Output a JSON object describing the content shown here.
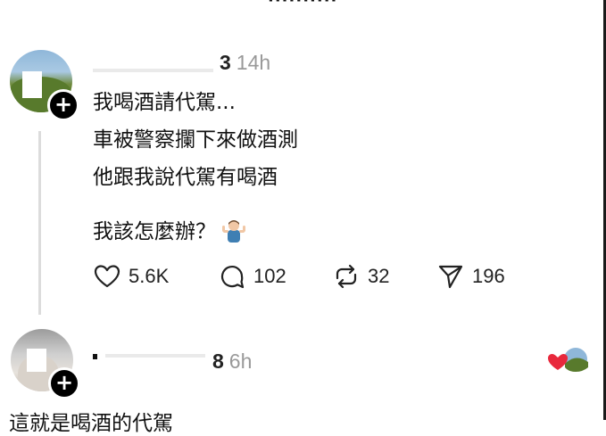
{
  "header_clip": "··········",
  "post": {
    "username_suffix": "3",
    "time": "14h",
    "lines": [
      "我喝酒請代駕...",
      "車被警察攔下來做酒測",
      "他跟我說代駕有喝酒",
      "我該怎麼辦？"
    ],
    "emoji": "man-shrugging",
    "stats": {
      "likes": "5.6K",
      "replies": "102",
      "reposts": "32",
      "shares": "196"
    }
  },
  "reply": {
    "username_suffix": "8",
    "time": "6h",
    "text": "這就是喝酒的代駕"
  },
  "colors": {
    "heart": "#e8283c",
    "muted": "#999999",
    "thread_line": "#dcdcdc"
  }
}
